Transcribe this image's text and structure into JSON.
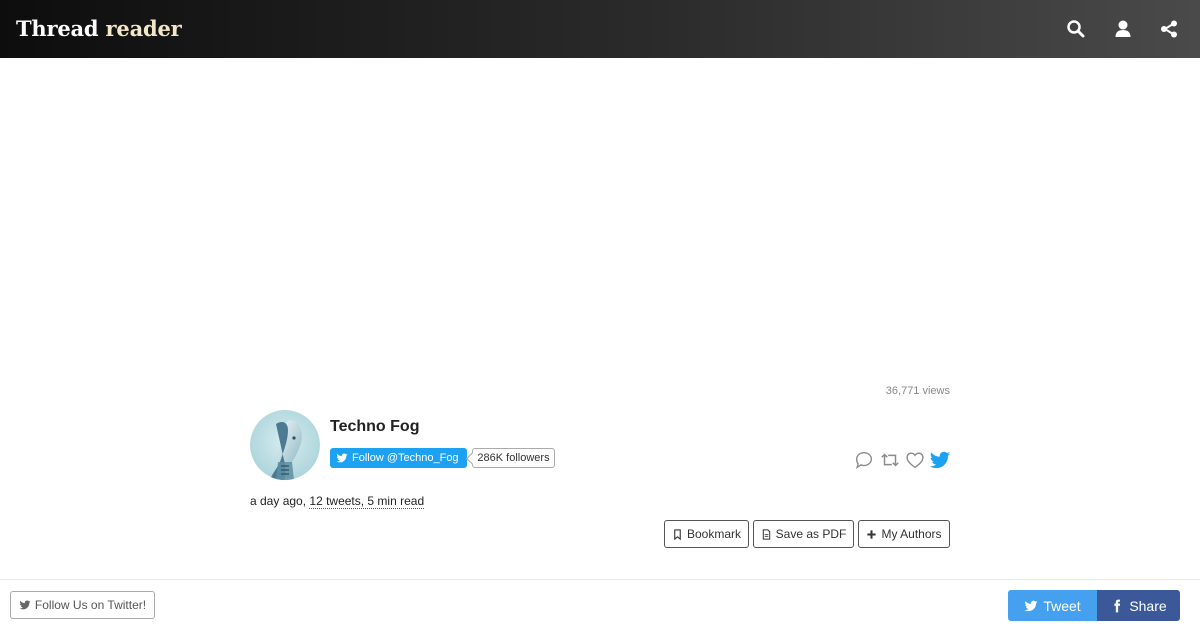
{
  "header": {
    "brand_part1": "Thread",
    "brand_part2": "reader",
    "icons": [
      "search-icon",
      "user-icon",
      "share-icon"
    ]
  },
  "thread": {
    "views": "36,771 views",
    "author_name": "Techno Fog",
    "follow_label": "Follow @Techno_Fog",
    "followers": "286K followers",
    "time_ago": "a day ago,",
    "tweets_read": "12 tweets, 5 min read"
  },
  "actions": [
    "reply-icon",
    "retweet-icon",
    "like-icon",
    "twitter-icon"
  ],
  "toolbar": {
    "bookmark": "Bookmark",
    "save_pdf": "Save as PDF",
    "my_authors": "My Authors"
  },
  "footer": {
    "follow_us": "Follow Us on Twitter!",
    "tweet": "Tweet",
    "share": "Share"
  },
  "colors": {
    "twitter_blue": "#1da1f2",
    "share_tweet": "#45a0ef",
    "facebook": "#3b5998",
    "header_dark": "#0d0d0d"
  }
}
